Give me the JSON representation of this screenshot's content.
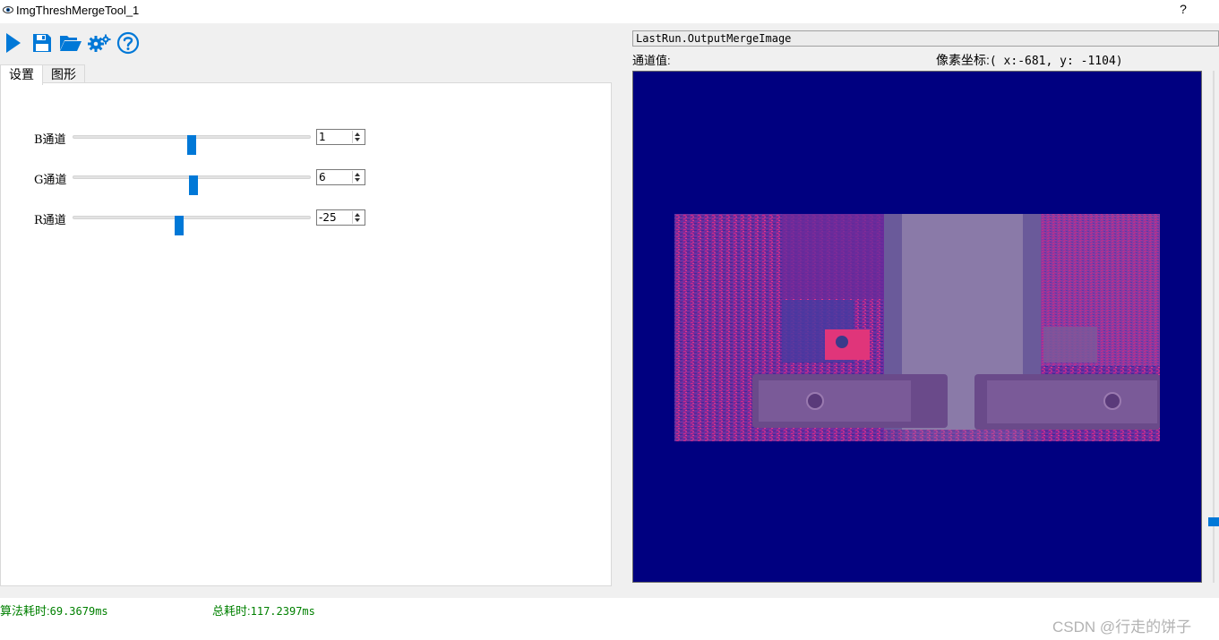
{
  "window": {
    "title": "ImgThreshMergeTool_1",
    "help_label": "?"
  },
  "toolbar": {
    "items": [
      {
        "name": "run",
        "icon": "play-icon"
      },
      {
        "name": "save",
        "icon": "save-icon"
      },
      {
        "name": "open",
        "icon": "folder-open-icon"
      },
      {
        "name": "settings",
        "icon": "gear-icon"
      },
      {
        "name": "help",
        "icon": "help-circle-icon"
      }
    ],
    "accent": "#0078d7"
  },
  "tabs": [
    {
      "label": "设置",
      "active": true
    },
    {
      "label": "图形",
      "active": false
    }
  ],
  "settings": {
    "sliders": [
      {
        "label": "B通道",
        "value": "1",
        "position": 0.5
      },
      {
        "label": "G通道",
        "value": "6",
        "position": 0.51
      },
      {
        "label": "R通道",
        "value": "-25",
        "position": 0.44
      }
    ]
  },
  "viewer": {
    "header": "LastRun.OutputMergeImage",
    "channel_label": "通道值:",
    "coord_label": "像素坐标:",
    "coord_value": "( x:-681, y: -1104)",
    "background": "#000080"
  },
  "status": {
    "algo_label": "算法耗时:",
    "algo_value": "69.3679ms",
    "total_label": "总耗时:",
    "total_value": "117.2397ms",
    "color": "#008000"
  },
  "watermark": "CSDN @行走的饼子"
}
